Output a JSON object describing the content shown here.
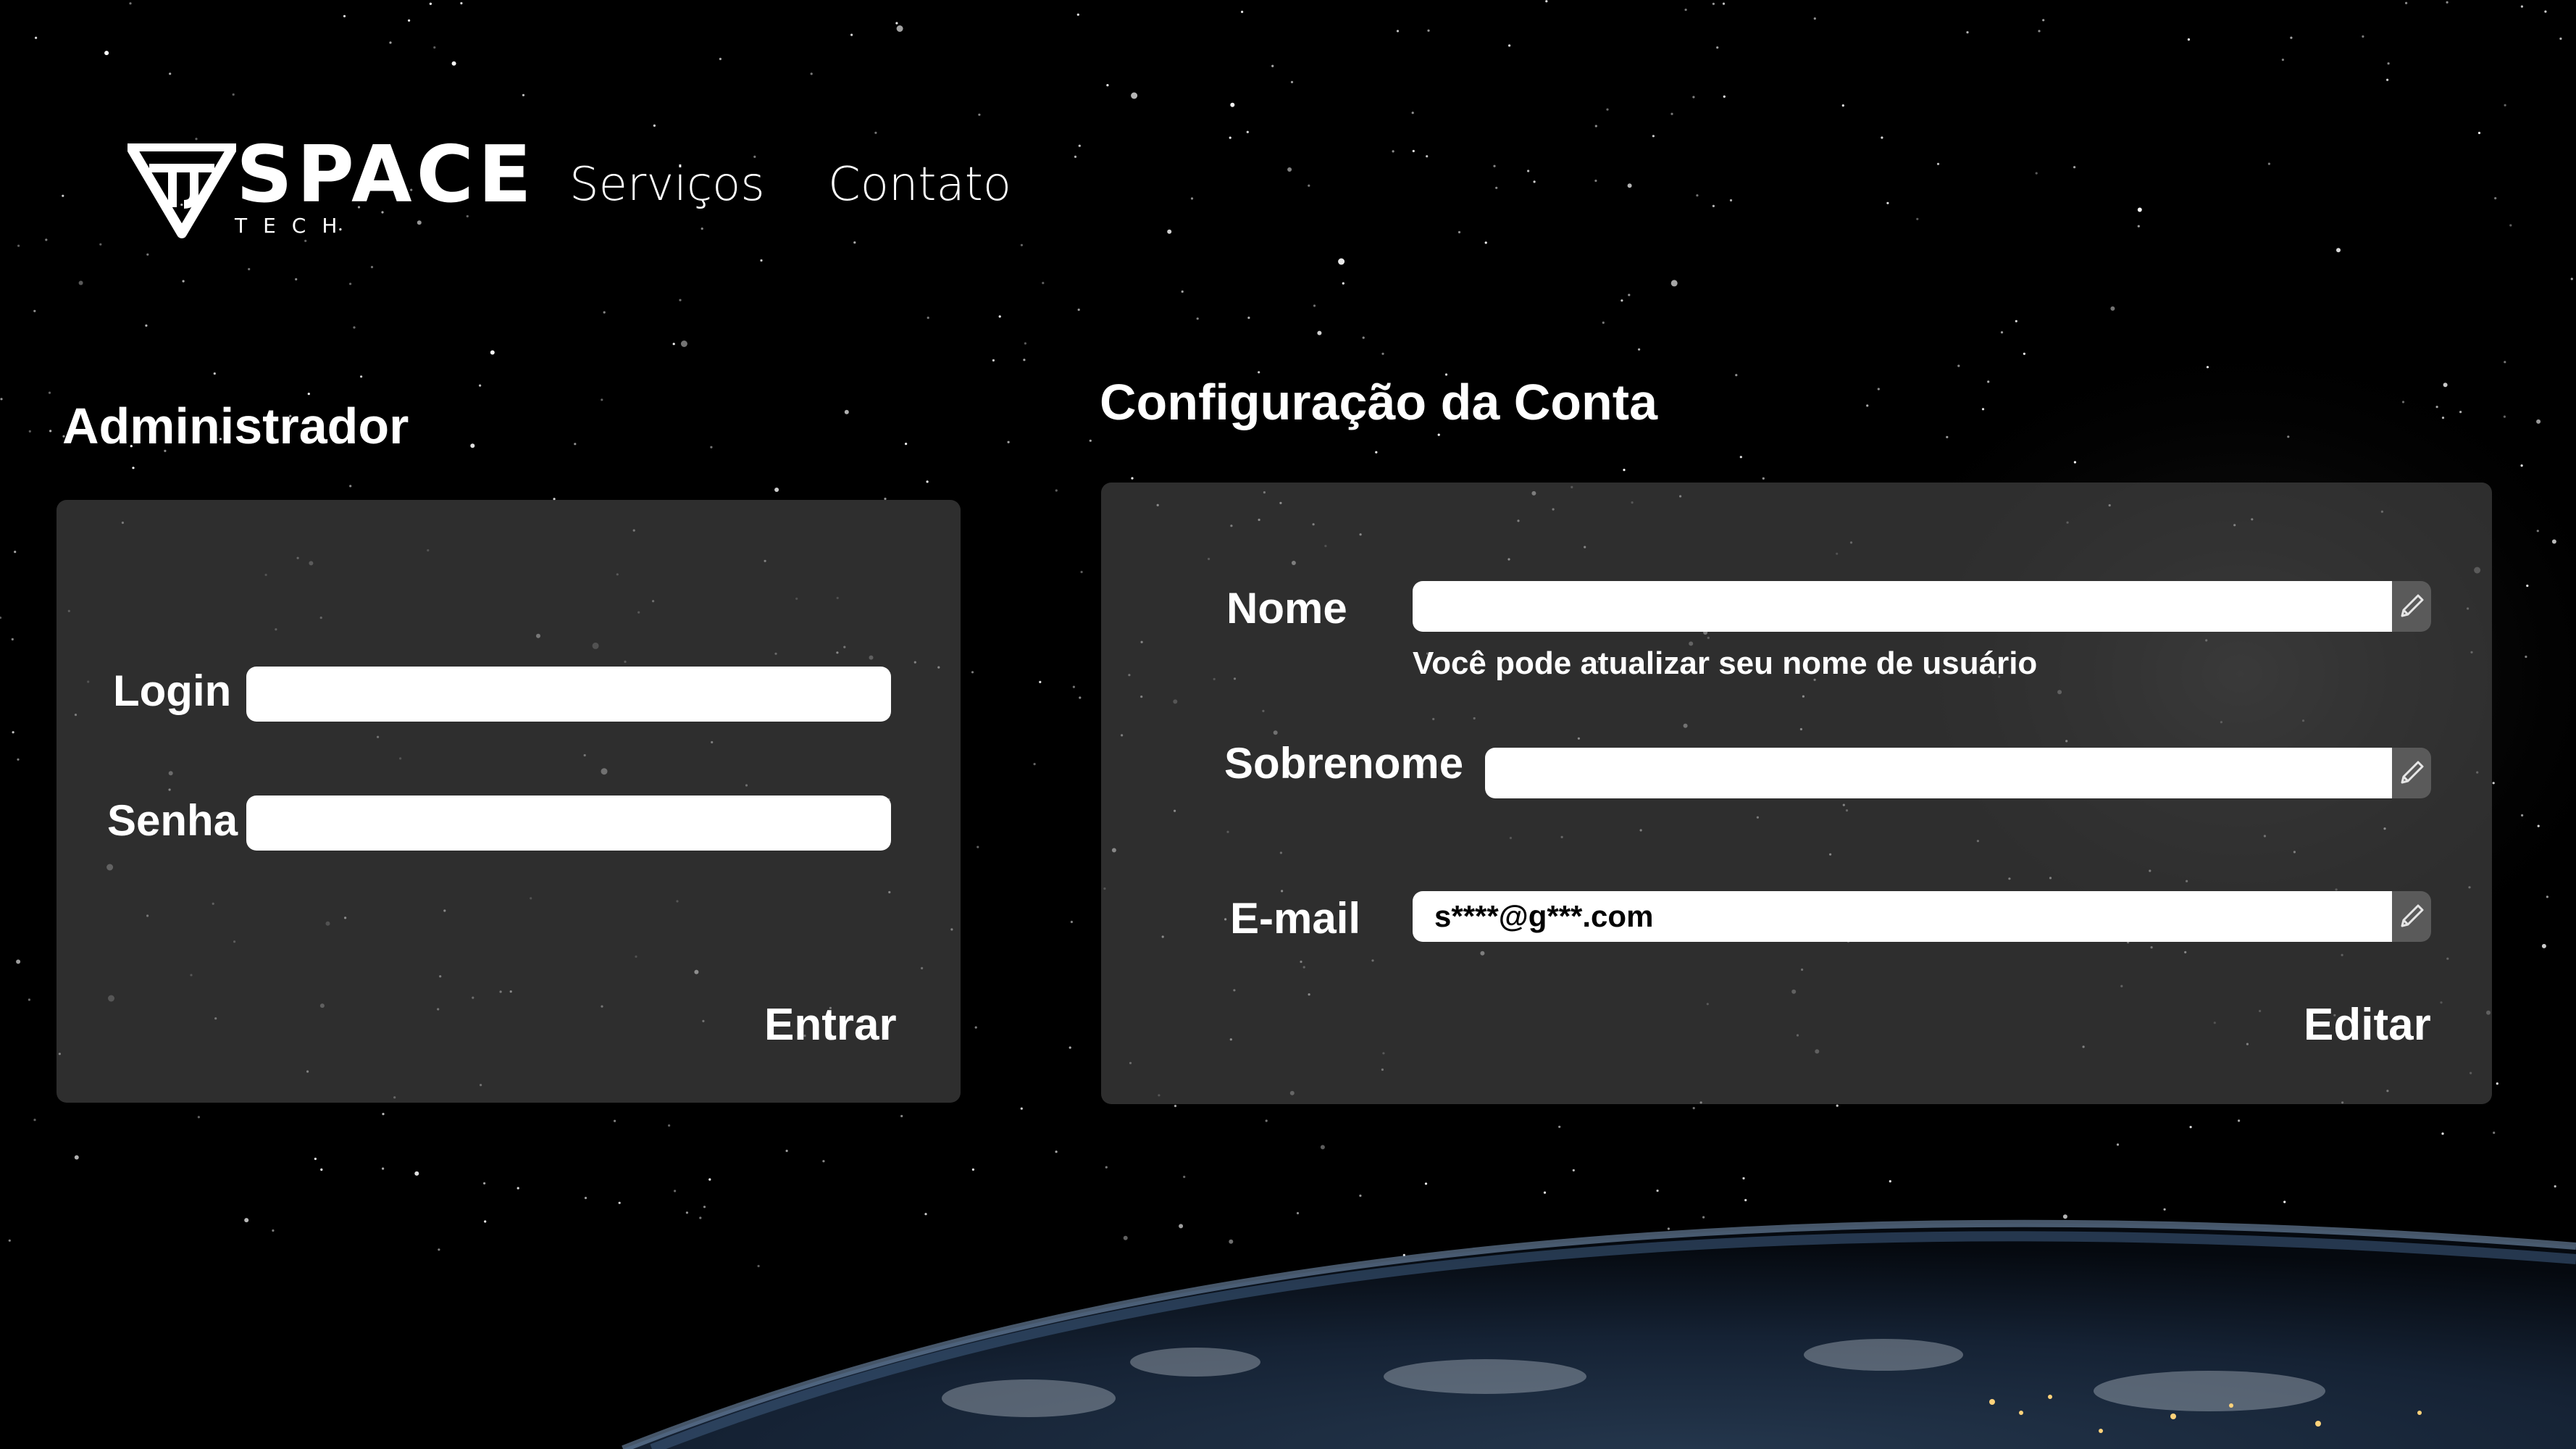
{
  "header": {
    "logo": {
      "word": "SPACE",
      "sub": "TECH"
    },
    "nav": [
      {
        "label": "Serviços"
      },
      {
        "label": "Contato"
      }
    ]
  },
  "admin": {
    "title": "Administrador",
    "login_label": "Login",
    "login_value": "",
    "password_label": "Senha",
    "password_value": "",
    "submit_label": "Entrar"
  },
  "account": {
    "title": "Configuração da Conta",
    "name_label": "Nome",
    "name_value": "",
    "name_hint": "Você pode atualizar seu nome de usuário",
    "surname_label": "Sobrenome",
    "surname_value": "",
    "email_label": "E-mail",
    "email_value": "s****@g***.com",
    "edit_label": "Editar"
  },
  "icons": {
    "edit_field": "pencil-icon",
    "logo_mark": "triangle-logo-icon"
  },
  "colors": {
    "background": "#000000",
    "panel": "#4a4a4a",
    "input": "#ffffff",
    "text": "#ffffff"
  }
}
